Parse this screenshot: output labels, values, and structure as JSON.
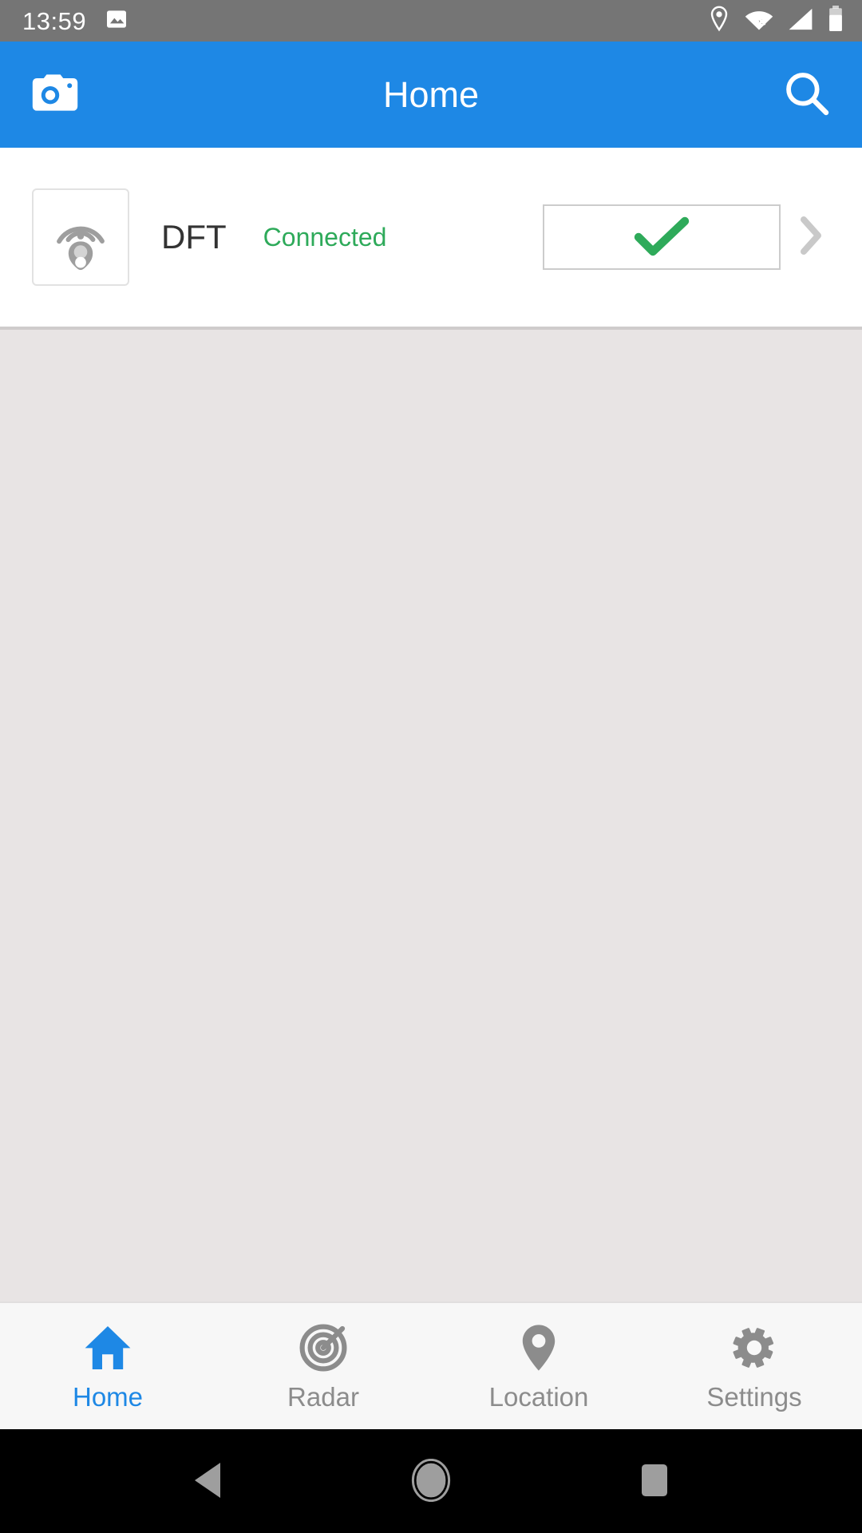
{
  "status_bar": {
    "time": "13:59",
    "icons": {
      "gallery": "image-icon",
      "location": "location-pin-icon",
      "wifi": "wifi-off-icon",
      "signal": "cellular-signal-icon",
      "battery": "battery-icon"
    }
  },
  "app_bar": {
    "title": "Home",
    "left_icon": "camera-icon",
    "right_icon": "search-icon",
    "background_color": "#1e88e5"
  },
  "device": {
    "icon": "beacon-tag-icon",
    "name": "DFT",
    "status": "Connected",
    "status_color": "#2eaa5a",
    "action_icon": "check-icon",
    "disclosure_icon": "chevron-right-icon"
  },
  "bottom_nav": {
    "active_color": "#1e88e5",
    "inactive_color": "#8c8c8c",
    "items": [
      {
        "label": "Home",
        "icon": "home-icon",
        "active": true
      },
      {
        "label": "Radar",
        "icon": "radar-target-icon",
        "active": false
      },
      {
        "label": "Location",
        "icon": "location-pin-icon",
        "active": false
      },
      {
        "label": "Settings",
        "icon": "gear-icon",
        "active": false
      }
    ]
  },
  "system_nav": {
    "back": "back-triangle-icon",
    "home": "home-circle-icon",
    "recents": "recents-square-icon"
  }
}
